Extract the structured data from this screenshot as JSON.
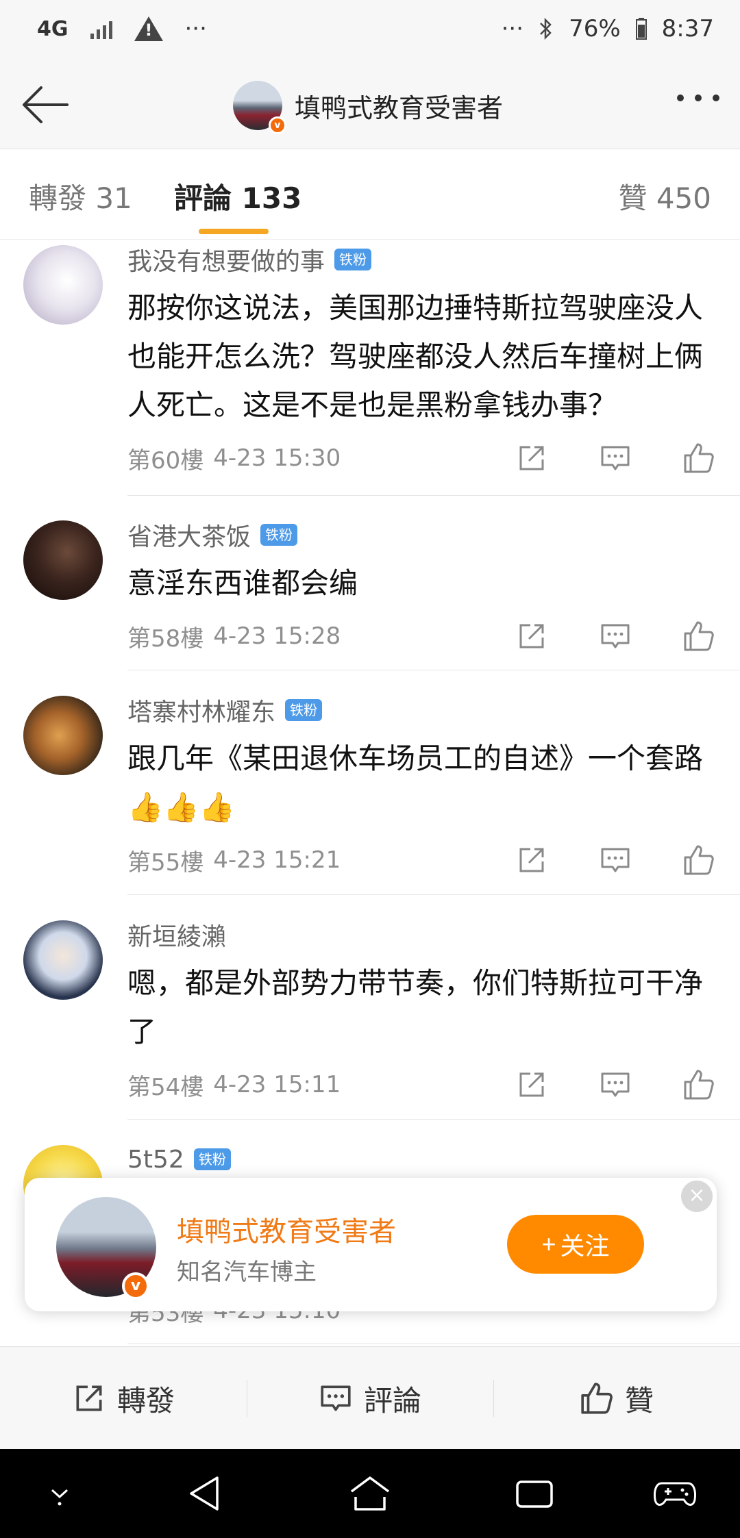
{
  "status_bar": {
    "network": "4G",
    "battery": "76%",
    "time": "8:37",
    "dots_left": "···",
    "dots_right": "···"
  },
  "header": {
    "author_name": "填鸭式教育受害者"
  },
  "tabs": {
    "repost": "轉發 31",
    "comments": "評論 133",
    "likes": "贊 450"
  },
  "comments": [
    {
      "user": "我没有想要做的事",
      "badge": "铁粉",
      "text": "那按你这说法，美国那边捶特斯拉驾驶座没人也能开怎么洗？驾驶座都没人然后车撞树上俩人死亡。这是不是也是黑粉拿钱办事？",
      "floor": "第60樓",
      "time": "4-23 15:30"
    },
    {
      "user": "省港大茶饭",
      "badge": "铁粉",
      "text": "意淫东西谁都会编",
      "floor": "第58樓",
      "time": "4-23 15:28"
    },
    {
      "user": "塔寨村林耀东",
      "badge": "铁粉",
      "text": "跟几年《某田退休车场员工的自述》一个套路👍👍👍",
      "floor": "第55樓",
      "time": "4-23 15:21"
    },
    {
      "user": "新垣綾瀨",
      "badge": "",
      "text": "嗯，都是外部势力带节奏，你们特斯拉可干净了",
      "floor": "第54樓",
      "time": "4-23 15:11"
    },
    {
      "user": "5t52",
      "badge": "铁粉",
      "text": "",
      "floor": "第53樓",
      "time": "4-23 15:10"
    }
  ],
  "popup": {
    "name": "填鸭式教育受害者",
    "desc": "知名汽车博主",
    "follow_label": "关注",
    "follow_prefix": "+"
  },
  "action_bar": {
    "repost": "轉發",
    "comment": "評論",
    "like": "贊"
  },
  "colors": {
    "accent": "#ff8a00",
    "tab_underline": "#f5a623",
    "fan_badge": "#4d9ae8"
  }
}
